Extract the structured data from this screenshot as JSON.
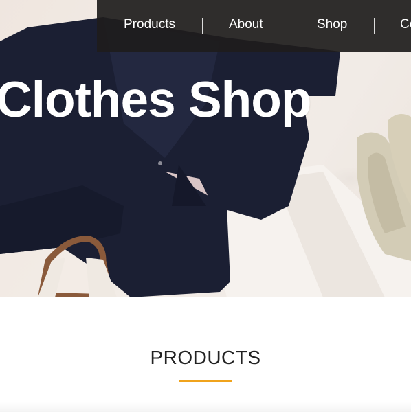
{
  "nav": {
    "items": [
      {
        "label": "Products"
      },
      {
        "label": "About"
      },
      {
        "label": "Shop"
      },
      {
        "label": "Co"
      }
    ]
  },
  "hero": {
    "title": "Clothes Shop"
  },
  "products_section": {
    "heading": "PRODUCTS"
  },
  "colors": {
    "nav_background": "#1e1c1c",
    "accent_underline": "#f0a31c",
    "heading_text": "#222222"
  }
}
